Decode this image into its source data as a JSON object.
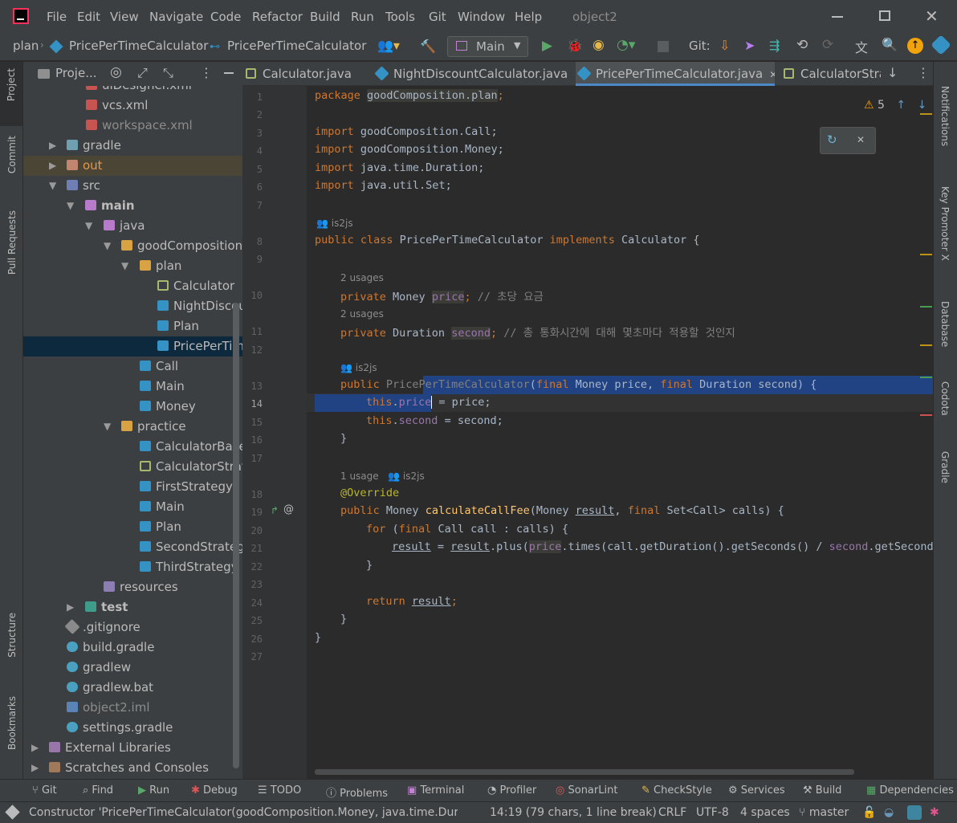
{
  "menu": [
    "File",
    "Edit",
    "View",
    "Navigate",
    "Code",
    "Refactor",
    "Build",
    "Run",
    "Tools",
    "Git",
    "Window",
    "Help"
  ],
  "window_title": "object2",
  "breadcrumb": {
    "items": [
      "plan",
      "PricePerTimeCalculator",
      "PricePerTimeCalculator"
    ]
  },
  "run_config": "Main",
  "git_label": "Git:",
  "tabs": [
    {
      "label": "Calculator.java"
    },
    {
      "label": "NightDiscountCalculator.java"
    },
    {
      "label": "PricePerTimeCalculator.java"
    },
    {
      "label": "CalculatorStra"
    }
  ],
  "project_panel": {
    "title": "Proje..."
  },
  "tree": [
    {
      "label": "uiDesigner.xml"
    },
    {
      "label": "vcs.xml"
    },
    {
      "label": "workspace.xml"
    },
    {
      "label": "gradle"
    },
    {
      "label": "out"
    },
    {
      "label": "src"
    },
    {
      "label": "main"
    },
    {
      "label": "java"
    },
    {
      "label": "goodComposition"
    },
    {
      "label": "plan"
    },
    {
      "label": "Calculator"
    },
    {
      "label": "NightDiscou"
    },
    {
      "label": "Plan"
    },
    {
      "label": "PricePerTime"
    },
    {
      "label": "Call"
    },
    {
      "label": "Main"
    },
    {
      "label": "Money"
    },
    {
      "label": "practice"
    },
    {
      "label": "CalculatorBasec"
    },
    {
      "label": "CalculatorStrate"
    },
    {
      "label": "FirstStrategy"
    },
    {
      "label": "Main"
    },
    {
      "label": "Plan"
    },
    {
      "label": "SecondStrategy"
    },
    {
      "label": "ThirdStrategy"
    },
    {
      "label": "resources"
    },
    {
      "label": "test"
    },
    {
      "label": ".gitignore"
    },
    {
      "label": "build.gradle"
    },
    {
      "label": "gradlew"
    },
    {
      "label": "gradlew.bat"
    },
    {
      "label": "object2.iml"
    },
    {
      "label": "settings.gradle"
    },
    {
      "label": "External Libraries"
    },
    {
      "label": "Scratches and Consoles"
    }
  ],
  "editor": {
    "warnings": "5",
    "lines": [
      "1",
      "2",
      "3",
      "4",
      "5",
      "6",
      "7",
      "8",
      "9",
      "10",
      "11",
      "12",
      "13",
      "14",
      "15",
      "16",
      "17",
      "18",
      "19",
      "20",
      "21",
      "22",
      "23",
      "24",
      "25",
      "26",
      "27"
    ],
    "code": {
      "l1a": "package ",
      "l1b": "goodComposition.plan",
      ";": ";",
      "import_kw": "import ",
      "i1": "goodComposition.Call;",
      "i2": "goodComposition.Money;",
      "i3": "java.time.Duration;",
      "i4": "java.util.Set;",
      "author": "is2js",
      "l8a": "public class ",
      "l8b": "PricePerTimeCalculator ",
      "l8c": "implements ",
      "l8d": "Calculator {",
      "usages2": "2 usages",
      "l10a": "private ",
      "l10b": "Money ",
      "l10c": "price",
      "l10d": "; ",
      "l10e": "// 초당 요금",
      "l11b": "Duration ",
      "l11c": "second",
      "l11e": "// 총 통화시간에 대해 몇초마다 적용할 것인지",
      "l13a": "public ",
      "l13b": "PricePerTimeCalculator",
      "l13c": "(",
      "l13d": "final ",
      "l13e": "Money price, ",
      "l13g": "Duration second) {",
      "l14a": "this",
      "l14b": ".",
      "l14c": "price",
      "l14d": " = price;",
      "l15c": "second",
      "l15d": " = second;",
      "close": "}",
      "usage1": "1 usage",
      "l18": "@Override",
      "l19a": "public ",
      "l19b": "Money ",
      "l19c": "calculateCallFee",
      "l19d": "(Money ",
      "l19e": "result",
      "l19f": ", ",
      "l19g": "final ",
      "l19h": "Set<Call> calls) {",
      "l20a": "for ",
      "l20b": "(",
      "l20c": "final ",
      "l20d": "Call call : calls) {",
      "l21a": "result",
      "l21b": " = ",
      "l21c": "result",
      "l21d": ".plus(",
      "l21e": "price",
      "l21f": ".times(call.getDuration().getSeconds() / ",
      "l21g": "second",
      "l21h": ".getSeconds(",
      "l24a": "return ",
      "l24b": "result",
      "l24c": ";"
    }
  },
  "left_tools": [
    "Project",
    "Commit",
    "Pull Requests",
    "Structure",
    "Bookmarks"
  ],
  "right_tools": [
    "Notifications",
    "Key Promoter X",
    "Database",
    "Codota",
    "Gradle"
  ],
  "bottom_tools": [
    "Git",
    "Find",
    "Run",
    "Debug",
    "TODO",
    "Problems",
    "Terminal",
    "Profiler",
    "SonarLint",
    "CheckStyle",
    "Services",
    "Build",
    "Dependencies"
  ],
  "status": {
    "message": "Constructor 'PricePerTimeCalculator(goodComposition.Money, java.time.Durati",
    "position": "14:19 (79 chars, 1 line break)",
    "line_sep": "CRLF",
    "encoding": "UTF-8",
    "indent": "4 spaces",
    "branch": "master"
  },
  "colors": {
    "accent": "#4a88c7",
    "selection": "#214283",
    "keyword": "#cc7832",
    "field": "#9876aa"
  }
}
